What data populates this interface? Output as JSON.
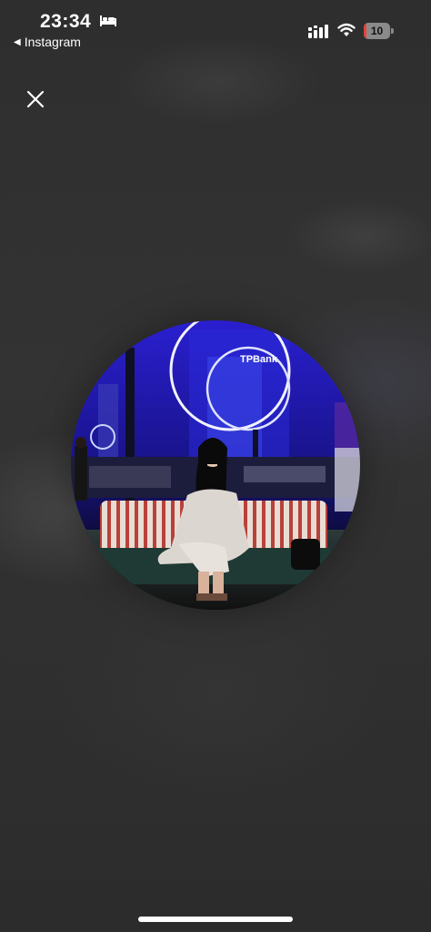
{
  "status_bar": {
    "time": "23:34",
    "back_app_label": "Instagram",
    "battery_level": "10",
    "battery_fraction": 0.1,
    "icons": [
      "bed-icon",
      "signal-icon",
      "wifi-icon",
      "battery-icon"
    ],
    "battery_color": "#e5413c"
  },
  "viewer": {
    "close_icon": "close-icon",
    "photo_sign_text": "TPBank"
  },
  "colors": {
    "background": "#2f2f2f",
    "night_sky": "#1a1aa8",
    "neon_ring": "#e8e8ff"
  }
}
